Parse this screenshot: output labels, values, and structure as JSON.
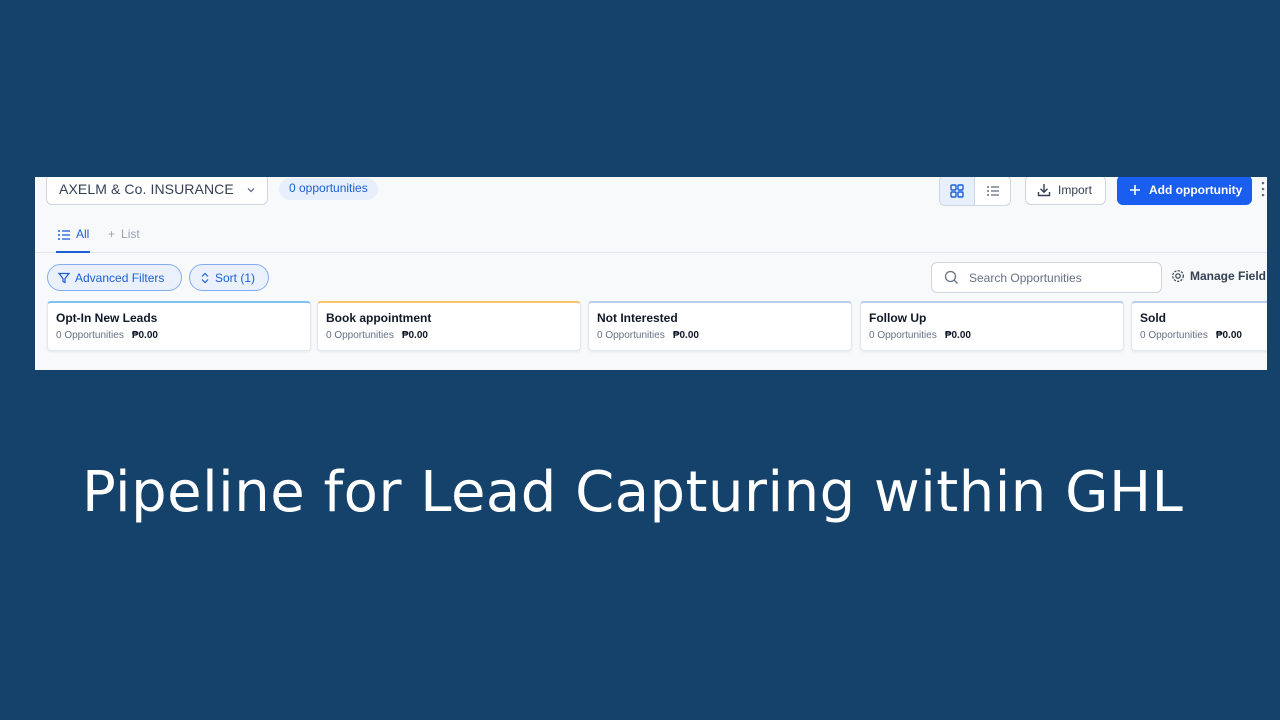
{
  "toolbar": {
    "pipeline_name": "AXELM & Co. INSURANCE",
    "opportunity_count": "0 opportunities",
    "import_label": "Import",
    "add_label": "Add opportunity"
  },
  "tabs": {
    "all_label": "All",
    "list_label": "List"
  },
  "filters": {
    "advanced_filters_label": "Advanced Filters",
    "sort_label": "Sort (1)",
    "search_placeholder": "Search Opportunities",
    "manage_fields_label": "Manage Field"
  },
  "stages": [
    {
      "name": "Opt-In New Leads",
      "count": "0 Opportunities",
      "amount": "₱0.00",
      "color": "#7cc4ee"
    },
    {
      "name": "Book appointment",
      "count": "0 Opportunities",
      "amount": "₱0.00",
      "color": "#f6c76a"
    },
    {
      "name": "Not Interested",
      "count": "0 Opportunities",
      "amount": "₱0.00",
      "color": "#b8cdea"
    },
    {
      "name": "Follow Up",
      "count": "0 Opportunities",
      "amount": "₱0.00",
      "color": "#b8cdea"
    },
    {
      "name": "Sold",
      "count": "0 Opportunities",
      "amount": "₱0.00",
      "color": "#b8cdea"
    }
  ],
  "headline": "Pipeline for Lead Capturing within GHL",
  "colors": {
    "background": "#15426a",
    "accent": "#1a5ef0"
  }
}
